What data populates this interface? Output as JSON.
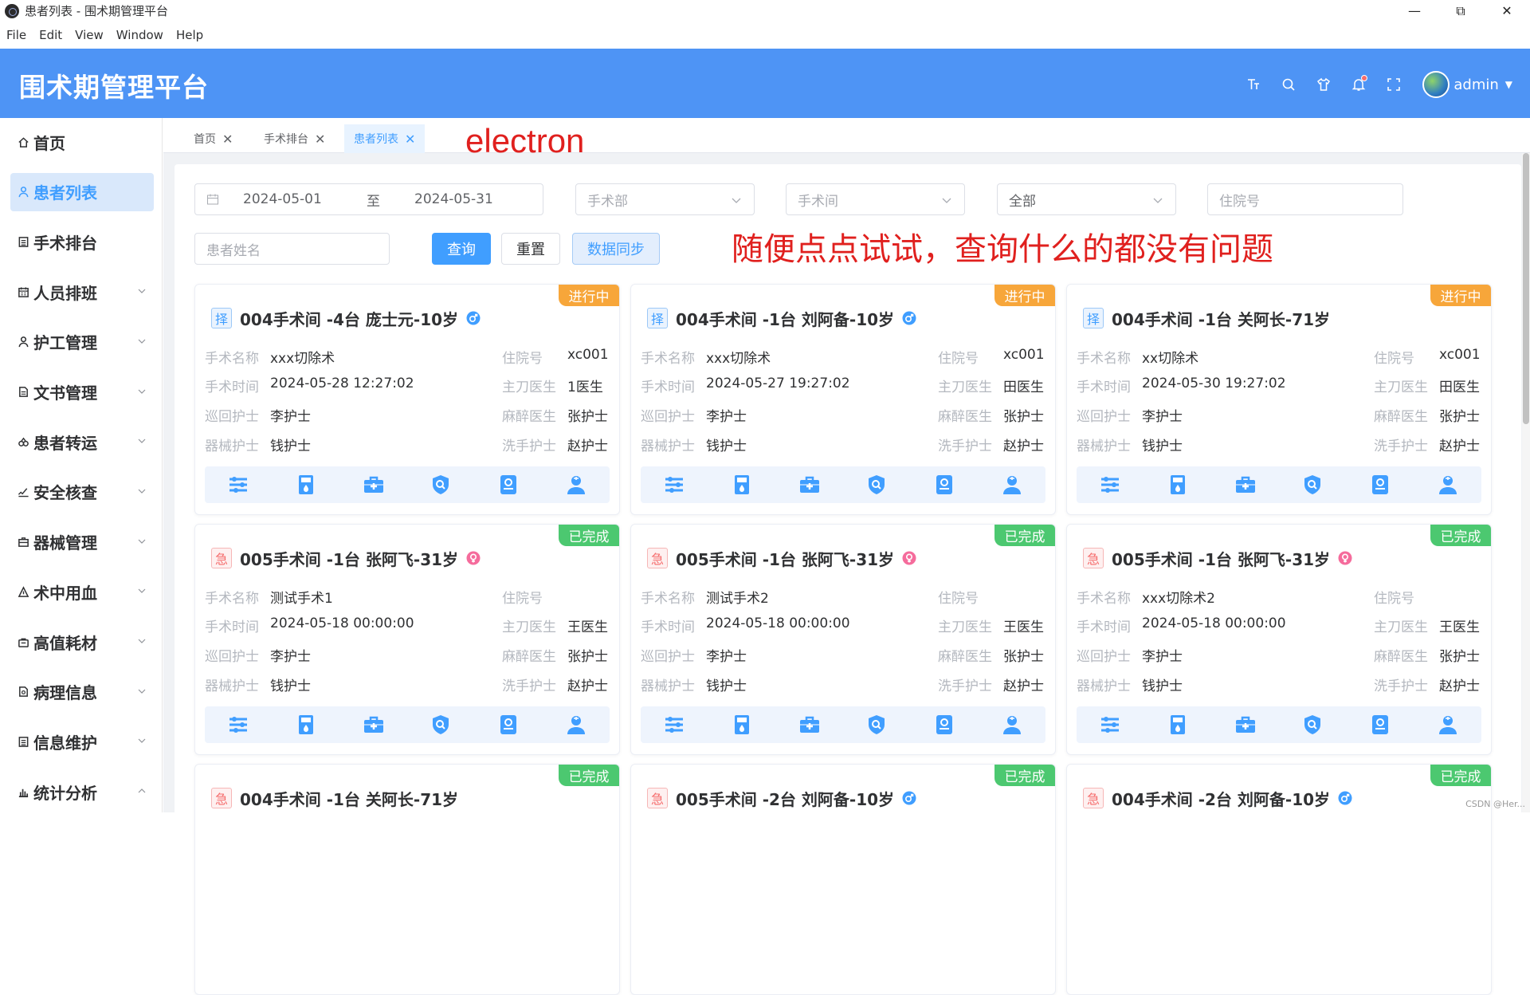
{
  "window": {
    "title": "患者列表 - 围术期管理平台"
  },
  "menubar": [
    "File",
    "Edit",
    "View",
    "Window",
    "Help"
  ],
  "header": {
    "brand": "围术期管理平台",
    "username": "admin"
  },
  "sidebar": {
    "items": [
      {
        "label": "首页",
        "icon": "home-icon",
        "active": false,
        "expandable": false
      },
      {
        "label": "患者列表",
        "icon": "user-icon",
        "active": true,
        "expandable": false
      },
      {
        "label": "手术排台",
        "icon": "list-icon",
        "active": false,
        "expandable": false
      },
      {
        "label": "人员排班",
        "icon": "calendar-icon",
        "active": false,
        "expandable": true
      },
      {
        "label": "护工管理",
        "icon": "user-icon",
        "active": false,
        "expandable": true
      },
      {
        "label": "文书管理",
        "icon": "document-icon",
        "active": false,
        "expandable": true
      },
      {
        "label": "患者转运",
        "icon": "transfer-icon",
        "active": false,
        "expandable": true
      },
      {
        "label": "安全核查",
        "icon": "check-icon",
        "active": false,
        "expandable": true
      },
      {
        "label": "器械管理",
        "icon": "toolbox-icon",
        "active": false,
        "expandable": true
      },
      {
        "label": "术中用血",
        "icon": "blood-icon",
        "active": false,
        "expandable": true
      },
      {
        "label": "高值耗材",
        "icon": "bag-icon",
        "active": false,
        "expandable": true
      },
      {
        "label": "病理信息",
        "icon": "report-icon",
        "active": false,
        "expandable": true
      },
      {
        "label": "信息维护",
        "icon": "list-icon",
        "active": false,
        "expandable": true
      },
      {
        "label": "统计分析",
        "icon": "bar-chart-icon",
        "active": false,
        "expandable": true
      }
    ]
  },
  "tabs": [
    {
      "label": "首页",
      "active": false
    },
    {
      "label": "手术排台",
      "active": false
    },
    {
      "label": "患者列表",
      "active": true
    }
  ],
  "annotations": {
    "electron": "electron",
    "test_note": "随便点点试试，查询什么的都没有问题"
  },
  "filters": {
    "date_start": "2024-05-01",
    "date_sep": "至",
    "date_end": "2024-05-31",
    "dept_placeholder": "手术部",
    "room_placeholder": "手术间",
    "status_value": "全部",
    "inpatient_placeholder": "住院号",
    "name_placeholder": "患者姓名",
    "query_label": "查询",
    "reset_label": "重置",
    "sync_label": "数据同步"
  },
  "labels": {
    "op_name": "手术名称",
    "op_time": "手术时间",
    "circ_nurse": "巡回护士",
    "inst_nurse": "器械护士",
    "inpatient_no": "住院号",
    "surgeon": "主刀医生",
    "anesth": "麻醉医生",
    "scrub_nurse": "洗手护士"
  },
  "colors": {
    "primary": "#409eff",
    "header_bg": "#4e94f5",
    "status_in_progress": "#f7a63a",
    "status_done": "#4cc870",
    "annotation": "#e0201e"
  },
  "cards": [
    {
      "tag": "择",
      "tag_type": "elective",
      "title": "004手术间 -4台 庞士元-10岁",
      "gender": "male",
      "status": "进行中",
      "status_type": "in-progress",
      "op_name": "xxx切除术",
      "op_time": "2024-05-28 12:27:02",
      "circ_nurse": "李护士",
      "inst_nurse": "钱护士",
      "inpatient_no": "xc001",
      "surgeon": "1医生",
      "anesth": "张护士",
      "scrub_nurse": "赵护士"
    },
    {
      "tag": "择",
      "tag_type": "elective",
      "title": "004手术间 -1台 刘阿备-10岁",
      "gender": "male",
      "status": "进行中",
      "status_type": "in-progress",
      "op_name": "xxx切除术",
      "op_time": "2024-05-27 19:27:02",
      "circ_nurse": "李护士",
      "inst_nurse": "钱护士",
      "inpatient_no": "xc001",
      "surgeon": "田医生",
      "anesth": "张护士",
      "scrub_nurse": "赵护士"
    },
    {
      "tag": "择",
      "tag_type": "elective",
      "title": "004手术间 -1台 关阿长-71岁",
      "gender": "",
      "status": "进行中",
      "status_type": "in-progress",
      "op_name": "xx切除术",
      "op_time": "2024-05-30 19:27:02",
      "circ_nurse": "李护士",
      "inst_nurse": "钱护士",
      "inpatient_no": "xc001",
      "surgeon": "田医生",
      "anesth": "张护士",
      "scrub_nurse": "赵护士"
    },
    {
      "tag": "急",
      "tag_type": "emergency",
      "title": "005手术间 -1台 张阿飞-31岁",
      "gender": "female",
      "status": "已完成",
      "status_type": "done",
      "op_name": "测试手术1",
      "op_time": "2024-05-18 00:00:00",
      "circ_nurse": "李护士",
      "inst_nurse": "钱护士",
      "inpatient_no": "",
      "surgeon": "王医生",
      "anesth": "张护士",
      "scrub_nurse": "赵护士"
    },
    {
      "tag": "急",
      "tag_type": "emergency",
      "title": "005手术间 -1台 张阿飞-31岁",
      "gender": "female",
      "status": "已完成",
      "status_type": "done",
      "op_name": "测试手术2",
      "op_time": "2024-05-18 00:00:00",
      "circ_nurse": "李护士",
      "inst_nurse": "钱护士",
      "inpatient_no": "",
      "surgeon": "王医生",
      "anesth": "张护士",
      "scrub_nurse": "赵护士"
    },
    {
      "tag": "急",
      "tag_type": "emergency",
      "title": "005手术间 -1台 张阿飞-31岁",
      "gender": "female",
      "status": "已完成",
      "status_type": "done",
      "op_name": "xxx切除术2",
      "op_time": "2024-05-18 00:00:00",
      "circ_nurse": "李护士",
      "inst_nurse": "钱护士",
      "inpatient_no": "",
      "surgeon": "王医生",
      "anesth": "张护士",
      "scrub_nurse": "赵护士"
    },
    {
      "tag": "急",
      "tag_type": "emergency",
      "title": "004手术间 -1台 关阿长-71岁",
      "gender": "",
      "status": "已完成",
      "status_type": "done"
    },
    {
      "tag": "急",
      "tag_type": "emergency",
      "title": "005手术间 -2台 刘阿备-10岁",
      "gender": "male",
      "status": "已完成",
      "status_type": "done"
    },
    {
      "tag": "急",
      "tag_type": "emergency",
      "title": "004手术间 -2台 刘阿备-10岁",
      "gender": "male",
      "status": "已完成",
      "status_type": "done"
    }
  ],
  "card_actions": [
    "settings-sliders-icon",
    "device-icon",
    "medical-kit-icon",
    "shield-icon",
    "record-icon",
    "nurse-icon"
  ],
  "watermark": "CSDN @Her..."
}
